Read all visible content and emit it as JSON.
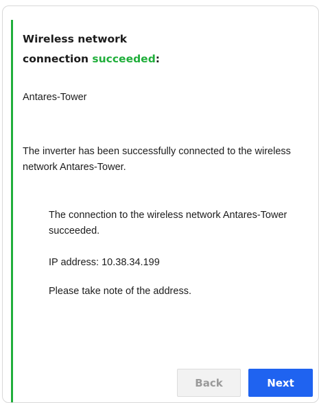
{
  "dialog": {
    "title_prefix": "Wireless network",
    "title_line2_prefix": "connection ",
    "title_status": "succeeded",
    "title_suffix": ":",
    "network_name": "Antares-Tower",
    "message": "The inverter has been successfully connected to the wireless network Antares-Tower.",
    "details": {
      "connection_text": "The connection to the wireless network Antares-Tower succeeded.",
      "ip_text": "IP address: 10.38.34.199",
      "note_text": "Please take note of the address."
    }
  },
  "buttons": {
    "back_label": "Back",
    "next_label": "Next"
  },
  "colors": {
    "accent_green": "#1fae3a",
    "primary_blue": "#1f63f0",
    "disabled_gray": "#9a9a9a"
  }
}
